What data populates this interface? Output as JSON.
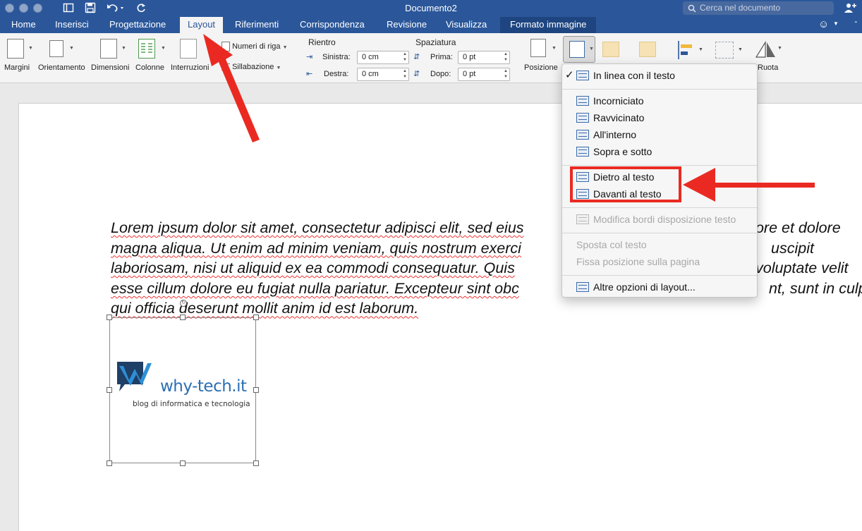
{
  "titlebar": {
    "title": "Documento2",
    "search_placeholder": "Cerca nel documento"
  },
  "tabs": [
    {
      "label": "Home"
    },
    {
      "label": "Inserisci"
    },
    {
      "label": "Progettazione"
    },
    {
      "label": "Layout"
    },
    {
      "label": "Riferimenti"
    },
    {
      "label": "Corrispondenza"
    },
    {
      "label": "Revisione"
    },
    {
      "label": "Visualizza"
    },
    {
      "label": "Formato immagine"
    }
  ],
  "active_tab": "Layout",
  "ribbon": {
    "margins": "Margini",
    "orientation": "Orientamento",
    "size": "Dimensioni",
    "columns": "Colonne",
    "breaks": "Interruzioni",
    "line_numbers": "Numeri di riga",
    "hyphenation": "Sillabazione",
    "indent_group": "Rientro",
    "indent_left_label": "Sinistra:",
    "indent_left_value": "0 cm",
    "indent_right_label": "Destra:",
    "indent_right_value": "0 cm",
    "spacing_group": "Spaziatura",
    "spacing_before_label": "Prima:",
    "spacing_before_value": "0 pt",
    "spacing_after_label": "Dopo:",
    "spacing_after_value": "0 pt",
    "position": "Posizione",
    "rotate": "Ruota"
  },
  "document": {
    "lines": [
      "Lorem ipsum dolor sit amet, consectetur adipisci elit, sed eius",
      "magna aliqua. Ut enim ad minim veniam, quis nostrum exerci",
      "laboriosam, nisi ut aliquid ex ea commodi consequatur. Quis",
      "esse cillum dolore eu fugiat nulla pariatur. Excepteur sint obc",
      "qui officia deserunt mollit anim id est laborum."
    ],
    "line_tails": [
      "bore et dolore",
      "uscipit",
      "voluptate velit",
      "nt, sunt in culpa",
      ""
    ],
    "logo_text": "why-tech.it",
    "logo_tagline": "blog di informatica e tecnologia"
  },
  "wrap_menu": {
    "items": [
      {
        "label": "In linea con il testo",
        "checked": true,
        "enabled": true
      },
      {
        "label": "Incorniciato",
        "enabled": true
      },
      {
        "label": "Ravvicinato",
        "enabled": true
      },
      {
        "label": "All'interno",
        "enabled": true
      },
      {
        "label": "Sopra e sotto",
        "enabled": true
      },
      {
        "label": "Dietro al testo",
        "enabled": true
      },
      {
        "label": "Davanti al testo",
        "enabled": true
      },
      {
        "label": "Modifica bordi disposizione testo",
        "enabled": false
      },
      {
        "label": "Sposta col testo",
        "enabled": false
      },
      {
        "label": "Fissa posizione sulla pagina",
        "enabled": false
      },
      {
        "label": "Altre opzioni di layout...",
        "enabled": true
      }
    ]
  },
  "colors": {
    "word_blue": "#2b579a",
    "annotation_red": "#ea2a22"
  }
}
